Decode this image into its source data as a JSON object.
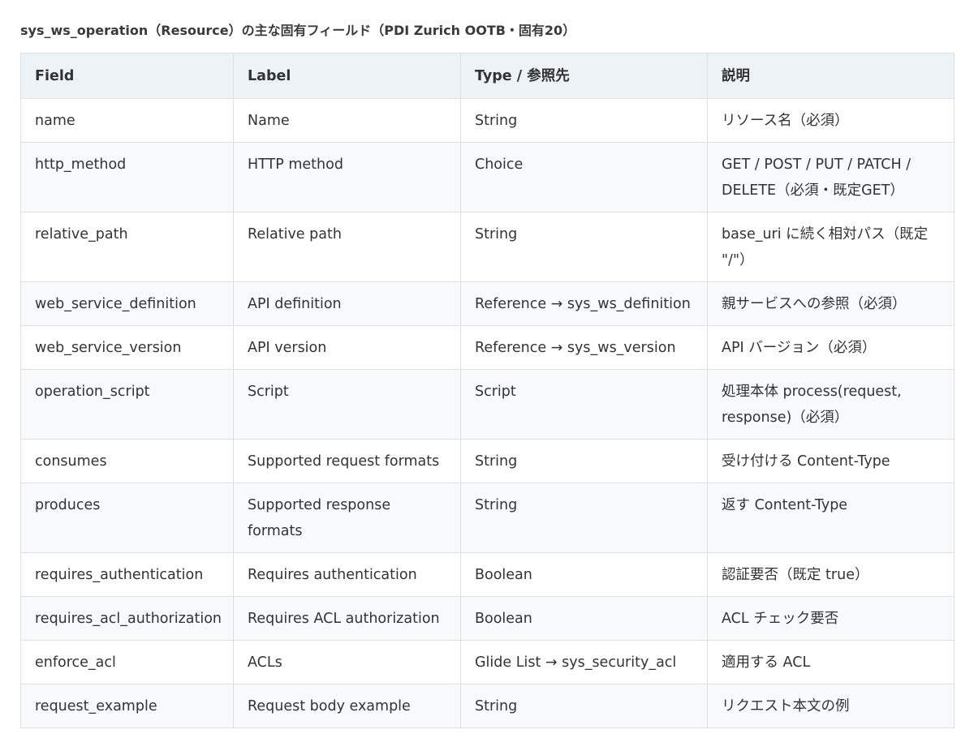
{
  "caption": "sys_ws_operation（Resource）の主な固有フィールド（PDI Zurich OOTB・固有20）",
  "table": {
    "headers": [
      "Field",
      "Label",
      "Type / 参照先",
      "説明"
    ],
    "rows": [
      [
        "name",
        "Name",
        "String",
        "リソース名（必須）"
      ],
      [
        "http_method",
        "HTTP method",
        "Choice",
        "GET / POST / PUT / PATCH / DELETE（必須・既定GET）"
      ],
      [
        "relative_path",
        "Relative path",
        "String",
        "base_uri に続く相対パス（既定 \"/\"）"
      ],
      [
        "web_service_definition",
        "API definition",
        "Reference → sys_ws_definition",
        "親サービスへの参照（必須）"
      ],
      [
        "web_service_version",
        "API version",
        "Reference → sys_ws_version",
        "API バージョン（必須）"
      ],
      [
        "operation_script",
        "Script",
        "Script",
        "処理本体 process(request, response)（必須）"
      ],
      [
        "consumes",
        "Supported request formats",
        "String",
        "受け付ける Content-Type"
      ],
      [
        "produces",
        "Supported response formats",
        "String",
        "返す Content-Type"
      ],
      [
        "requires_authentication",
        "Requires authentication",
        "Boolean",
        "認証要否（既定 true）"
      ],
      [
        "requires_acl_authorization",
        "Requires ACL authorization",
        "Boolean",
        "ACL チェック要否"
      ],
      [
        "enforce_acl",
        "ACLs",
        "Glide List → sys_security_acl",
        "適用する ACL"
      ],
      [
        "request_example",
        "Request body example",
        "String",
        "リクエスト本文の例"
      ]
    ]
  }
}
